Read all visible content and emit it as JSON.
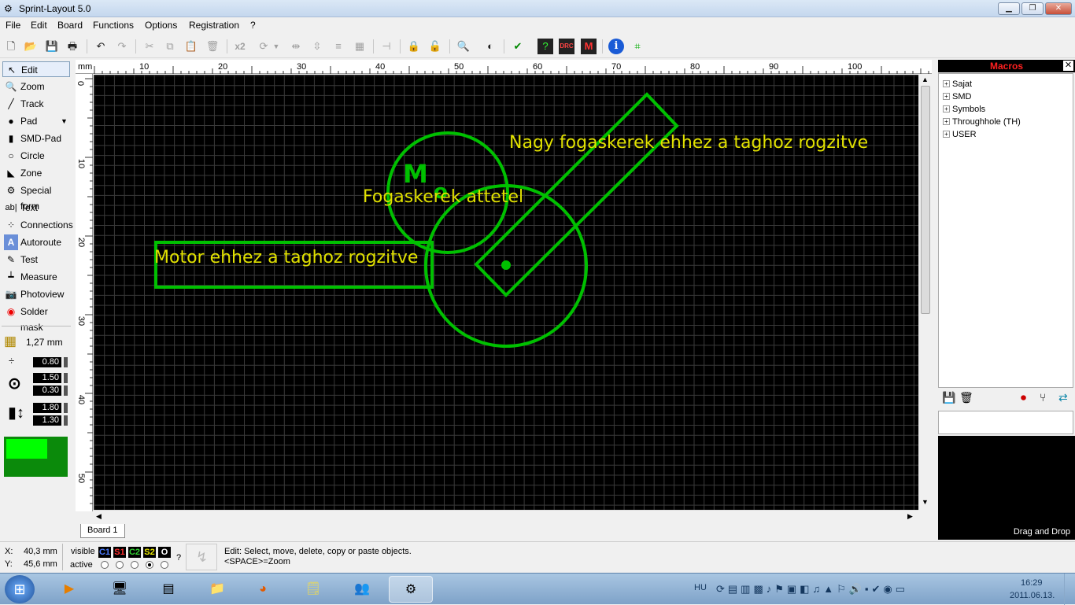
{
  "window": {
    "title": "Sprint-Layout 5.0",
    "btn_min": "▁",
    "btn_max": "❐",
    "btn_close": "✕"
  },
  "menu": [
    "File",
    "Edit",
    "Board",
    "Functions",
    "Options",
    "Registration",
    "?"
  ],
  "toolbar": {
    "icons": [
      "new-icon",
      "open-icon",
      "save-icon",
      "print-icon",
      "undo-icon",
      "redo-icon",
      "cut-icon",
      "copy-icon",
      "paste-icon",
      "delete-icon",
      "duplicate-icon",
      "rotate-icon",
      "mirror-horizontal-icon",
      "mirror-vertical-icon",
      "align-icon",
      "group-icon",
      "snap-icon",
      "lock-icon",
      "unlock-icon",
      "zoom-icon",
      "transparent-icon",
      "drc-icon",
      "info-icon",
      "crop-icon"
    ],
    "x2_label": "x2"
  },
  "tools": [
    {
      "label": "Edit",
      "icon": "pointer-icon",
      "glyph": "↖",
      "selected": true
    },
    {
      "label": "Zoom",
      "icon": "zoom-icon",
      "glyph": "🔍"
    },
    {
      "label": "Track",
      "icon": "track-icon",
      "glyph": "╱"
    },
    {
      "label": "Pad",
      "icon": "pad-icon",
      "glyph": "●"
    },
    {
      "label": "SMD-Pad",
      "icon": "smd-pad-icon",
      "glyph": "▮"
    },
    {
      "label": "Circle",
      "icon": "circle-icon",
      "glyph": "○"
    },
    {
      "label": "Zone",
      "icon": "zone-icon",
      "glyph": "◣"
    },
    {
      "label": "Special form",
      "icon": "special-form-icon",
      "glyph": "⚙"
    },
    {
      "label": "Text",
      "icon": "text-icon",
      "glyph": "ab|"
    },
    {
      "label": "Connections",
      "icon": "connections-icon",
      "glyph": "⁘"
    },
    {
      "label": "Autoroute",
      "icon": "autoroute-icon",
      "glyph": "A"
    },
    {
      "label": "Test",
      "icon": "test-icon",
      "glyph": "✎"
    },
    {
      "label": "Measure",
      "icon": "measure-icon",
      "glyph": "┷"
    },
    {
      "label": "Photoview",
      "icon": "photoview-icon",
      "glyph": "📷"
    },
    {
      "label": "Solder mask",
      "icon": "solder-mask-icon",
      "glyph": "◉"
    }
  ],
  "grid": {
    "value": "1,27 mm"
  },
  "params": {
    "track_width": "0.80",
    "pad_outer": "1.50",
    "pad_inner": "0.30",
    "smd_w": "1.80",
    "smd_h": "1.30"
  },
  "ruler": {
    "unit": "mm",
    "top_ticks": [
      "10",
      "20",
      "30",
      "40",
      "50",
      "60",
      "70",
      "80",
      "90",
      "100"
    ],
    "left_ticks": [
      "0",
      "10",
      "20",
      "30",
      "40",
      "50"
    ]
  },
  "board_texts": {
    "t1": "Nagy fogaskerek ehhez a taghoz rogzitve",
    "t2": "Fogaskerek attetel",
    "t3": "Motor ehhez a taghoz rogzitve",
    "t4": "M"
  },
  "colors": {
    "board": "#000000",
    "track": "#00c000",
    "text": "#e0e000",
    "grid": "#3a3a3a"
  },
  "board_tab": "Board 1",
  "macros": {
    "title": "Macros",
    "items": [
      "Sajat",
      "SMD",
      "Symbols",
      "Throughhole (TH)",
      "USER"
    ],
    "drag_hint": "Drag and Drop"
  },
  "status": {
    "x_label": "X:",
    "x_value": "40,3 mm",
    "y_label": "Y:",
    "y_value": "45,6 mm",
    "visible_label": "visible",
    "active_label": "active",
    "layers": [
      "C1",
      "S1",
      "C2",
      "S2",
      "O"
    ],
    "layer_colors": [
      "#4b7bff",
      "#ff3030",
      "#30d030",
      "#e8e800",
      "#ffffff"
    ],
    "help": "?",
    "message1": "Edit: Select, move, delete, copy or paste objects.",
    "message2": "<SPACE>=Zoom"
  },
  "taskbar": {
    "start_icon": "windows-start-icon",
    "apps": [
      "media-player-icon",
      "terminal-icon",
      "document-icon",
      "folder-icon",
      "firefox-icon",
      "sticky-notes-icon",
      "network-icon",
      "sprint-layout-icon"
    ],
    "lang": "HU",
    "time": "16:29",
    "date": "2011.06.13."
  }
}
